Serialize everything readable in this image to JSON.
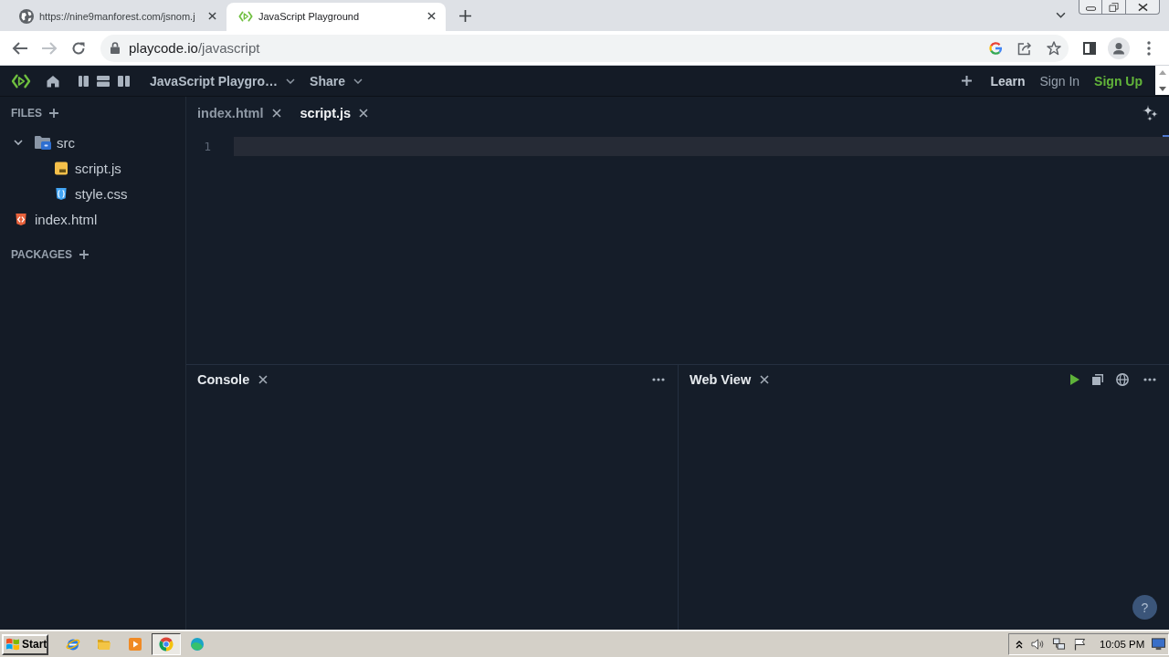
{
  "browser": {
    "tabs": [
      {
        "title": "https://nine9manforest.com/jsnom.j",
        "selected": false
      },
      {
        "title": "JavaScript Playground",
        "selected": true
      }
    ],
    "address": {
      "host": "playcode.io",
      "path": "/javascript"
    }
  },
  "header": {
    "menus": [
      {
        "label": "JavaScript Playgro…"
      },
      {
        "label": "Share"
      }
    ],
    "links": [
      {
        "label": "Learn",
        "kind": "bold"
      },
      {
        "label": "Sign In",
        "kind": "plain"
      },
      {
        "label": "Sign Up",
        "kind": "accent"
      }
    ]
  },
  "sidebar": {
    "files_title": "FILES",
    "files": [
      {
        "name": "src",
        "kind": "folder",
        "expanded": true,
        "children": [
          {
            "name": "script.js",
            "kind": "js"
          },
          {
            "name": "style.css",
            "kind": "css"
          }
        ]
      },
      {
        "name": "index.html",
        "kind": "html"
      }
    ],
    "packages_title": "PACKAGES"
  },
  "editor": {
    "tabs": [
      {
        "label": "index.html",
        "selected": false
      },
      {
        "label": "script.js",
        "selected": true
      }
    ],
    "line_numbers": [
      "1"
    ]
  },
  "panels": [
    {
      "title": "Console",
      "kind": "console"
    },
    {
      "title": "Web View",
      "kind": "webview"
    }
  ],
  "help": {
    "label": "?"
  },
  "taskbar": {
    "start": "Start",
    "apps": [
      {
        "selected": false
      },
      {
        "selected": false
      },
      {
        "selected": false
      },
      {
        "selected": true
      },
      {
        "selected": false
      }
    ],
    "clock": "10:05 PM"
  }
}
